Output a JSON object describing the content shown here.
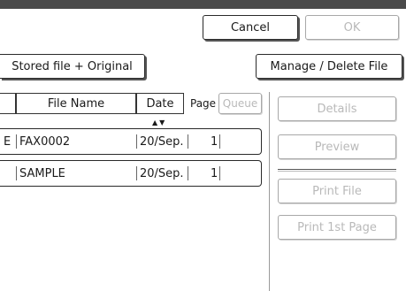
{
  "toolbar": {
    "cancel_label": "Cancel",
    "ok_label": "OK"
  },
  "filter": {
    "stored_label": "Stored file + Original",
    "manage_label": "Manage / Delete File"
  },
  "table": {
    "headers": {
      "file_name": "File Name",
      "date": "Date",
      "page": "Page",
      "queue": "Queue"
    },
    "rows": [
      {
        "prefix": "E",
        "file_name": "FAX0002",
        "date": "20/Sep.",
        "page": "1"
      },
      {
        "prefix": "",
        "file_name": "SAMPLE",
        "date": "20/Sep.",
        "page": "1"
      }
    ]
  },
  "actions": {
    "details": "Details",
    "preview": "Preview",
    "print_file": "Print File",
    "print_first_page": "Print 1st Page"
  },
  "sort_indicator": "▲▼",
  "colors": {
    "border": "#2a2a2a",
    "disabled_text": "#b9b9b9",
    "header_bar": "#4a4a4a"
  }
}
